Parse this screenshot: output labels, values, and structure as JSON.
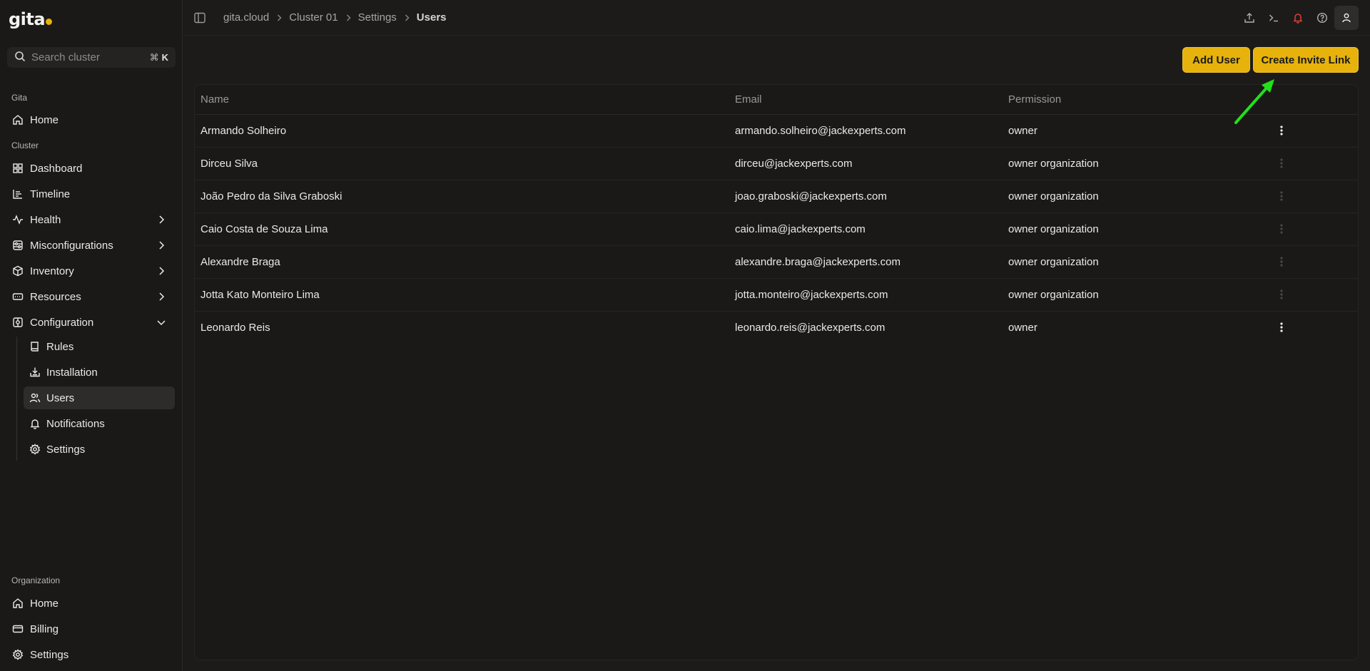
{
  "app": {
    "logo": "gita"
  },
  "search": {
    "placeholder": "Search cluster",
    "shortcut_symbol": "⌘",
    "shortcut_key": "K"
  },
  "sidebar": {
    "group_gita": "Gita",
    "home": "Home",
    "group_cluster": "Cluster",
    "cluster_items": [
      {
        "label": "Dashboard",
        "icon": "dashboard-icon"
      },
      {
        "label": "Timeline",
        "icon": "timeline-icon"
      },
      {
        "label": "Health",
        "icon": "activity-icon"
      },
      {
        "label": "Misconfigurations",
        "icon": "misconfig-icon"
      },
      {
        "label": "Inventory",
        "icon": "box-icon"
      },
      {
        "label": "Resources",
        "icon": "resources-icon"
      },
      {
        "label": "Configuration",
        "icon": "configuration-icon"
      }
    ],
    "config_sub": [
      {
        "label": "Rules",
        "icon": "book-icon"
      },
      {
        "label": "Installation",
        "icon": "download-icon"
      },
      {
        "label": "Users",
        "icon": "users-icon"
      },
      {
        "label": "Notifications",
        "icon": "bell-icon"
      },
      {
        "label": "Settings",
        "icon": "gear-icon"
      }
    ],
    "group_org": "Organization",
    "org_items": [
      {
        "label": "Home",
        "icon": "home-icon"
      },
      {
        "label": "Billing",
        "icon": "credit-card-icon"
      },
      {
        "label": "Settings",
        "icon": "gear-icon"
      }
    ]
  },
  "breadcrumb": [
    "gita.cloud",
    "Cluster 01",
    "Settings",
    "Users"
  ],
  "actions": {
    "add_user": "Add User",
    "create_invite": "Create Invite Link"
  },
  "table": {
    "headers": {
      "name": "Name",
      "email": "Email",
      "permission": "Permission"
    },
    "rows": [
      {
        "name": "Armando Solheiro",
        "email": "armando.solheiro@jackexperts.com",
        "permission": "owner",
        "menu_enabled": true
      },
      {
        "name": "Dirceu Silva",
        "email": "dirceu@jackexperts.com",
        "permission": "owner organization",
        "menu_enabled": false
      },
      {
        "name": "João Pedro da Silva Graboski",
        "email": "joao.graboski@jackexperts.com",
        "permission": "owner organization",
        "menu_enabled": false
      },
      {
        "name": "Caio Costa de Souza Lima",
        "email": "caio.lima@jackexperts.com",
        "permission": "owner organization",
        "menu_enabled": false
      },
      {
        "name": "Alexandre Braga",
        "email": "alexandre.braga@jackexperts.com",
        "permission": "owner organization",
        "menu_enabled": false
      },
      {
        "name": "Jotta Kato Monteiro Lima",
        "email": "jotta.monteiro@jackexperts.com",
        "permission": "owner organization",
        "menu_enabled": false
      },
      {
        "name": "Leonardo Reis",
        "email": "leonardo.reis@jackexperts.com",
        "permission": "owner",
        "menu_enabled": true
      }
    ]
  },
  "colors": {
    "accent": "#e6b20b",
    "annotation_arrow": "#22e01a",
    "notification": "#e0403a"
  }
}
